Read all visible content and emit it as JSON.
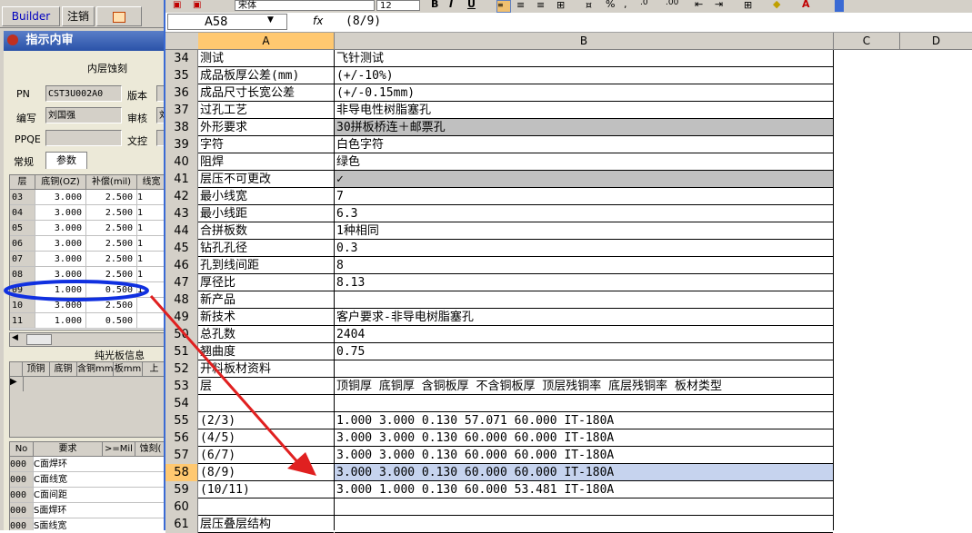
{
  "left_app": {
    "toolbar": {
      "builder": "Builder",
      "logout": "注销"
    },
    "panel_title": "指示内审",
    "subtitle": "内层蚀刻",
    "fields": {
      "pn_label": "PN",
      "pn_value": "CST3U002A0",
      "version_label": "版本",
      "writer_label": "编写",
      "writer_value": "刘国强",
      "review_label": "审核",
      "review_value": "刘",
      "ppqe_label": "PPQE",
      "doc_check_label": "文控"
    },
    "tabs": [
      "常规",
      "参数"
    ],
    "grid_headers": [
      "层",
      "底铜(OZ)",
      "补偿(mil)",
      "线宽"
    ],
    "grid_rows": [
      [
        "03",
        "3.000",
        "2.500",
        "1"
      ],
      [
        "04",
        "3.000",
        "2.500",
        "1"
      ],
      [
        "05",
        "3.000",
        "2.500",
        "1"
      ],
      [
        "06",
        "3.000",
        "2.500",
        "1"
      ],
      [
        "07",
        "3.000",
        "2.500",
        "1"
      ],
      [
        "08",
        "3.000",
        "2.500",
        "1"
      ],
      [
        "09",
        "1.000",
        "0.500",
        "1"
      ],
      [
        "10",
        "3.000",
        "2.500",
        ""
      ],
      [
        "11",
        "1.000",
        "0.500",
        ""
      ]
    ],
    "bare_board_title": "纯光板信息",
    "bare_headers": [
      "顶铜",
      "底铜",
      "含铜mm",
      "板mm",
      "上"
    ],
    "bottom_headers": [
      "No",
      "要求",
      ">=Mil",
      "蚀刻("
    ],
    "bottom_rows": [
      [
        "000",
        "C面焊环"
      ],
      [
        "000",
        "C面线宽"
      ],
      [
        "000",
        "C面间距"
      ],
      [
        "000",
        "S面焊环"
      ],
      [
        "000",
        "S面线宽"
      ]
    ]
  },
  "excel": {
    "font_name": "宋体",
    "font_size": "12",
    "name_box": "A58",
    "fx": "fx",
    "formula": "(8/9)",
    "columns": [
      "A",
      "B",
      "C",
      "D"
    ],
    "rows": [
      {
        "n": "34",
        "a": "测试",
        "b": "飞针测试"
      },
      {
        "n": "35",
        "a": "成品板厚公差(mm)",
        "b": "(+/-10%)"
      },
      {
        "n": "36",
        "a": "成品尺寸长宽公差",
        "b": "(+/-0.15mm)"
      },
      {
        "n": "37",
        "a": "过孔工艺",
        "b": "非导电性树脂塞孔"
      },
      {
        "n": "38",
        "a": "外形要求",
        "b": "30拼板桥连＋邮票孔",
        "gray": true
      },
      {
        "n": "39",
        "a": "字符",
        "b": "白色字符"
      },
      {
        "n": "40",
        "a": "阻焊",
        "b": "绿色"
      },
      {
        "n": "41",
        "a": "层压不可更改",
        "b": "✓",
        "gray": true
      },
      {
        "n": "42",
        "a": "最小线宽",
        "b": "7"
      },
      {
        "n": "43",
        "a": "最小线距",
        "b": "6.3"
      },
      {
        "n": "44",
        "a": "合拼板数",
        "b": "1种相同"
      },
      {
        "n": "45",
        "a": "钻孔孔径",
        "b": "0.3"
      },
      {
        "n": "46",
        "a": "孔到线间距",
        "b": "8"
      },
      {
        "n": "47",
        "a": "厚径比",
        "b": "8.13"
      },
      {
        "n": "48",
        "a": "新产品",
        "b": ""
      },
      {
        "n": "49",
        "a": "新技术",
        "b": "客户要求-非导电树脂塞孔"
      },
      {
        "n": "50",
        "a": "总孔数",
        "b": "2404"
      },
      {
        "n": "51",
        "a": "翘曲度",
        "b": "0.75"
      },
      {
        "n": "52",
        "a": "开料板材资料",
        "b": ""
      },
      {
        "n": "53",
        "a": "层",
        "b": "顶铜厚  底铜厚  含铜板厚  不含铜板厚  顶层残铜率  底层残铜率  板材类型"
      },
      {
        "n": "54",
        "a": "",
        "b": ""
      },
      {
        "n": "55",
        "a": "(2/3)",
        "b": "1.000   3.000         0.130       57.071     60.000      IT-180A"
      },
      {
        "n": "56",
        "a": "(4/5)",
        "b": "3.000   3.000         0.130       60.000     60.000      IT-180A"
      },
      {
        "n": "57",
        "a": "(6/7)",
        "b": "3.000   3.000         0.130       60.000     60.000      IT-180A"
      },
      {
        "n": "58",
        "a": "(8/9)",
        "b": "3.000   3.000         0.130       60.000     60.000      IT-180A",
        "sel": true
      },
      {
        "n": "59",
        "a": "(10/11)",
        "b": "3.000   1.000         0.130       60.000     53.481      IT-180A"
      },
      {
        "n": "60",
        "a": "",
        "b": ""
      },
      {
        "n": "61",
        "a": "层压叠层结构",
        "b": ""
      }
    ]
  }
}
